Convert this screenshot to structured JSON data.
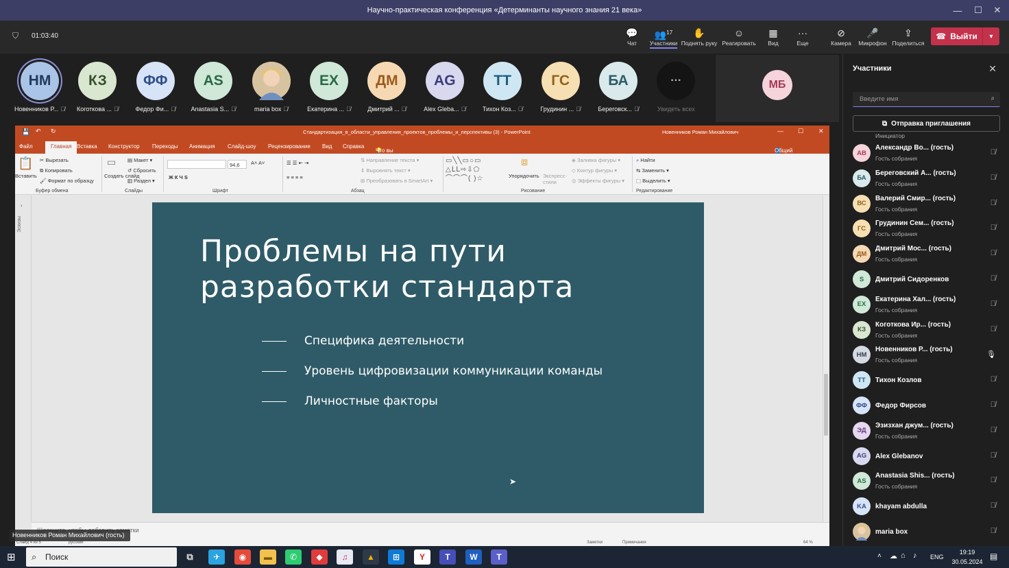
{
  "window": {
    "title": "Научно-практическая конференция «Детерминанты научного знания 21 века»",
    "minimize": "—",
    "maximize": "☐",
    "close": "✕"
  },
  "meeting": {
    "timer": "01:03:40",
    "participants_count": "17",
    "toolbar": [
      {
        "label": "Чат",
        "icon": "chat-icon",
        "glyph": "💬"
      },
      {
        "label": "Участники",
        "icon": "people-icon",
        "glyph": "👥"
      },
      {
        "label": "Поднять руку",
        "icon": "raise-hand-icon",
        "glyph": "✋"
      },
      {
        "label": "Реагировать",
        "icon": "react-icon",
        "glyph": "☺"
      },
      {
        "label": "Вид",
        "icon": "view-grid-icon",
        "glyph": "▦"
      },
      {
        "label": "Еще",
        "icon": "more-icon",
        "glyph": "···"
      },
      {
        "label": "Камера",
        "icon": "camera-off-icon",
        "glyph": "⊘"
      },
      {
        "label": "Микрофон",
        "icon": "mic-off-icon",
        "glyph": "🎤"
      },
      {
        "label": "Поделиться",
        "icon": "share-icon",
        "glyph": "⇪"
      }
    ],
    "leave_label": "Выйти"
  },
  "strip": {
    "participants": [
      {
        "initials": "НМ",
        "name": "Новенников Р...",
        "bg": "#a9c4e6",
        "fg": "#203a5c",
        "active": true
      },
      {
        "initials": "КЗ",
        "name": "Коготкова ...",
        "bg": "#d9e6d0",
        "fg": "#36502a"
      },
      {
        "initials": "ФФ",
        "name": "Федор Фи...",
        "bg": "#d7e3f7",
        "fg": "#2f4f8a"
      },
      {
        "initials": "AS",
        "name": "Anastasia S...",
        "bg": "#cfe8d8",
        "fg": "#2a6a45"
      },
      {
        "initials": "",
        "name": "maria box",
        "bg": "#c9a56f",
        "fg": "#fff",
        "photo": true
      },
      {
        "initials": "ЕХ",
        "name": "Екатерина ...",
        "bg": "#cfe8d8",
        "fg": "#2a6a45"
      },
      {
        "initials": "ДМ",
        "name": "Дмитрий ...",
        "bg": "#f6d9b3",
        "fg": "#9a5a1c"
      },
      {
        "initials": "AG",
        "name": "Alex Gleba...",
        "bg": "#d8d8ef",
        "fg": "#3d3d7a"
      },
      {
        "initials": "ТТ",
        "name": "Тихон Коз...",
        "bg": "#cfe6f3",
        "fg": "#1f5f80"
      },
      {
        "initials": "ГС",
        "name": "Грудинин ...",
        "bg": "#f6dfb2",
        "fg": "#93621c"
      },
      {
        "initials": "БА",
        "name": "Береговск...",
        "bg": "#d9e9ec",
        "fg": "#2d5c66"
      }
    ],
    "see_all": "Увидеть всех",
    "extra_tile": {
      "initials": "МБ",
      "bg": "#f6d4dc",
      "fg": "#a33b55"
    }
  },
  "ppt": {
    "file_title": "Стандартизация_в_области_управления_проектов_проблемы_и_перспективы (3)  -  PowerPoint",
    "user": "Новенников Роман Михайлович",
    "menu": [
      "Файл",
      "Главная",
      "Вставка",
      "Конструктор",
      "Переходы",
      "Анимация",
      "Слайд-шоу",
      "Рецензирование",
      "Вид",
      "Справка"
    ],
    "tell_me": "Что вы хотите сделать?",
    "share": "Общий доступ",
    "ribbon": {
      "paste": "Вставить",
      "cut": "Вырезать",
      "copy": "Копировать",
      "format_painter": "Формат по образцу",
      "group_clipboard": "Буфер обмена",
      "new_slide": "Создать слайд",
      "layout": "Макет",
      "reset": "Сбросить",
      "section": "Раздел",
      "group_slides": "Слайды",
      "font_size": "94,6",
      "group_font": "Шрифт",
      "text_dir": "Направление текста",
      "align_text": "Выровнять текст",
      "smartart": "Преобразовать в SmartArt",
      "group_paragraph": "Абзац",
      "arrange": "Упорядочить",
      "quick_styles": "Экспресс-стили",
      "shape_fill": "Заливка фигуры",
      "shape_outline": "Контур фигуры",
      "shape_effects": "Эффекты фигуры",
      "group_drawing": "Рисование",
      "find": "Найти",
      "replace": "Заменить",
      "select": "Выделить",
      "group_editing": "Редактирование"
    },
    "left_pane_label": "Эскизы",
    "slide": {
      "title_line1": "Проблемы на пути",
      "title_line2": "разработки стандарта",
      "bullets": [
        "Специфика деятельности",
        "Уровень цифровизации коммуникации команды",
        "Личностные факторы"
      ],
      "bg": "#2f5b68"
    },
    "notes_placeholder": "Щелкните, чтобы добавить заметки",
    "status_slide": "Слайд 4 из 5",
    "status_lang": "русский",
    "status_notes": "Заметки",
    "status_comments": "Примечания",
    "zoom": "64 %"
  },
  "caption": "Новенников Роман Михайлович (гость)",
  "panel": {
    "title": "Участники",
    "search_placeholder": "Введите имя",
    "invite": "Отправка приглашения",
    "initiator_label": "Инициатор",
    "people": [
      {
        "initials": "АВ",
        "name": "Александр Во...",
        "guest": "(гость)",
        "role": "Гость собрания",
        "bg": "#f6d4dc",
        "fg": "#a33b55",
        "mic": "off"
      },
      {
        "initials": "БА",
        "name": "Береговский А...",
        "guest": "(гость)",
        "role": "Гость собрания",
        "bg": "#d9e9ec",
        "fg": "#2d5c66",
        "mic": "off"
      },
      {
        "initials": "ВС",
        "name": "Валерий Смир...",
        "guest": "(гость)",
        "role": "Гость собрания",
        "bg": "#f6dfb2",
        "fg": "#93621c",
        "mic": "off"
      },
      {
        "initials": "ГС",
        "name": "Грудинин Сем...",
        "guest": "(гость)",
        "role": "Гость собрания",
        "bg": "#f6dfb2",
        "fg": "#93621c",
        "mic": "off"
      },
      {
        "initials": "ДМ",
        "name": "Дмитрий Мос...",
        "guest": "(гость)",
        "role": "Гость собрания",
        "bg": "#f6d9b3",
        "fg": "#9a5a1c",
        "mic": "off"
      },
      {
        "initials": "S",
        "name": "Дмитрий Сидоренков",
        "guest": "",
        "role": "",
        "bg": "#cfe8d8",
        "fg": "#2a6a45",
        "mic": "off"
      },
      {
        "initials": "ЕХ",
        "name": "Екатерина Хал...",
        "guest": "(гость)",
        "role": "Гость собрания",
        "bg": "#cfe8d8",
        "fg": "#2a6a45",
        "mic": "off"
      },
      {
        "initials": "КЗ",
        "name": "Коготкова Ир...",
        "guest": "(гость)",
        "role": "Гость собрания",
        "bg": "#d9e6d0",
        "fg": "#36502a",
        "mic": "off"
      },
      {
        "initials": "НМ",
        "name": "Новенников Р...",
        "guest": "(гость)",
        "role": "Гость собрания",
        "bg": "#d6dbe3",
        "fg": "#34404f",
        "mic": "on"
      },
      {
        "initials": "ТТ",
        "name": "Тихон Козлов",
        "guest": "",
        "role": "",
        "bg": "#cfe6f3",
        "fg": "#1f5f80",
        "mic": "off"
      },
      {
        "initials": "ФФ",
        "name": "Федор Фирсов",
        "guest": "",
        "role": "",
        "bg": "#d7e3f7",
        "fg": "#2f4f8a",
        "mic": "off"
      },
      {
        "initials": "ЭД",
        "name": "Эзизхан джум...",
        "guest": "(гость)",
        "role": "Гость собрания",
        "bg": "#e6d7f0",
        "fg": "#5c3a7a",
        "mic": "off"
      },
      {
        "initials": "AG",
        "name": "Alex Glebanov",
        "guest": "",
        "role": "",
        "bg": "#d8d8ef",
        "fg": "#3d3d7a",
        "mic": "off"
      },
      {
        "initials": "AS",
        "name": "Anastasia Shis...",
        "guest": "(гость)",
        "role": "Гость собрания",
        "bg": "#cfe8d8",
        "fg": "#2a6a45",
        "mic": "off"
      },
      {
        "initials": "KA",
        "name": "khayam abdulla",
        "guest": "",
        "role": "",
        "bg": "#d7e3f7",
        "fg": "#2f4f8a",
        "mic": "off"
      },
      {
        "initials": "",
        "name": "maria box",
        "guest": "",
        "role": "",
        "bg": "#c9a56f",
        "fg": "#fff",
        "mic": "off",
        "photo": true
      }
    ]
  },
  "taskbar": {
    "search": "Поиск",
    "lang": "ENG",
    "time": "19:19",
    "date": "30.05.2024"
  }
}
